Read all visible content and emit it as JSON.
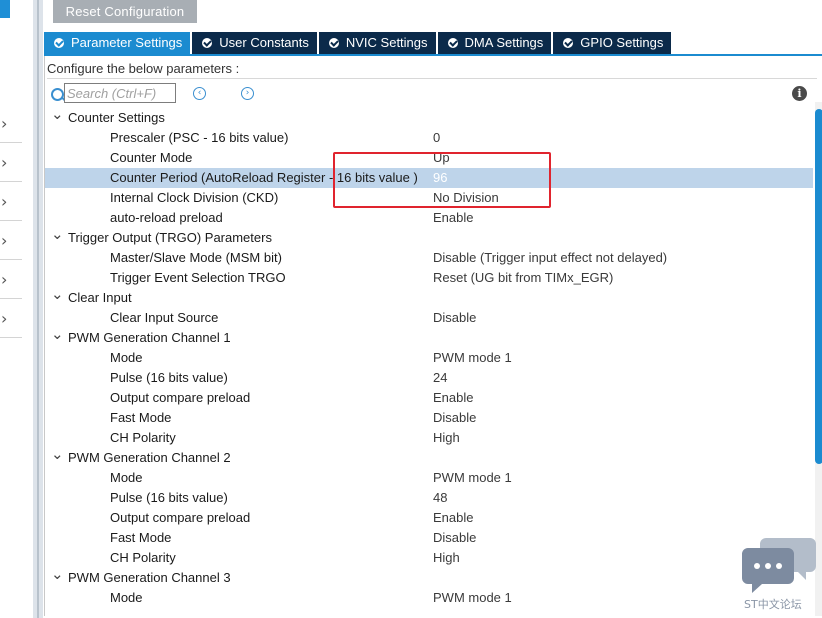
{
  "toolbar": {
    "reset_label": "Reset Configuration"
  },
  "tabs": [
    {
      "label": "Parameter Settings",
      "active": true
    },
    {
      "label": "User Constants",
      "active": false
    },
    {
      "label": "NVIC Settings",
      "active": false
    },
    {
      "label": "DMA Settings",
      "active": false
    },
    {
      "label": "GPIO Settings",
      "active": false
    }
  ],
  "panel": {
    "configure_label": "Configure the below parameters :",
    "search_placeholder": "Search (Ctrl+F)"
  },
  "groups": [
    {
      "title": "Counter Settings",
      "params": [
        {
          "name": "Prescaler (PSC - 16 bits value)",
          "value": "0"
        },
        {
          "name": "Counter Mode",
          "value": "Up"
        },
        {
          "name": "Counter Period (AutoReload Register - 16 bits value )",
          "value": "96",
          "selected": true
        },
        {
          "name": "Internal Clock Division (CKD)",
          "value": "No Division"
        },
        {
          "name": "auto-reload preload",
          "value": "Enable"
        }
      ]
    },
    {
      "title": "Trigger Output (TRGO) Parameters",
      "params": [
        {
          "name": "Master/Slave Mode (MSM bit)",
          "value": "Disable (Trigger input effect not delayed)"
        },
        {
          "name": "Trigger Event Selection TRGO",
          "value": "Reset (UG bit from TIMx_EGR)"
        }
      ]
    },
    {
      "title": "Clear Input",
      "params": [
        {
          "name": "Clear Input Source",
          "value": "Disable"
        }
      ]
    },
    {
      "title": "PWM Generation Channel 1",
      "params": [
        {
          "name": "Mode",
          "value": "PWM mode 1"
        },
        {
          "name": "Pulse (16 bits value)",
          "value": "24"
        },
        {
          "name": "Output compare preload",
          "value": "Enable"
        },
        {
          "name": "Fast Mode",
          "value": "Disable"
        },
        {
          "name": "CH Polarity",
          "value": "High"
        }
      ]
    },
    {
      "title": "PWM Generation Channel 2",
      "params": [
        {
          "name": "Mode",
          "value": "PWM mode 1"
        },
        {
          "name": "Pulse (16 bits value)",
          "value": "48"
        },
        {
          "name": "Output compare preload",
          "value": "Enable"
        },
        {
          "name": "Fast Mode",
          "value": "Disable"
        },
        {
          "name": "CH Polarity",
          "value": "High"
        }
      ]
    },
    {
      "title": "PWM Generation Channel 3",
      "params": [
        {
          "name": "Mode",
          "value": "PWM mode 1"
        }
      ]
    }
  ],
  "watermark": {
    "text": "ST中文论坛"
  },
  "icons": {
    "search": "search-icon",
    "prev": "arrow-left-circle-icon",
    "next": "arrow-right-circle-icon",
    "info": "info-icon",
    "group_toggle": "chevron-down-icon",
    "tab_status": "check-circle-icon"
  },
  "colors": {
    "active_tab": "#1b8bd0",
    "inactive_tab": "#0b2a4a",
    "selected_row": "#bed4ea",
    "highlight_box": "#e0242e"
  }
}
